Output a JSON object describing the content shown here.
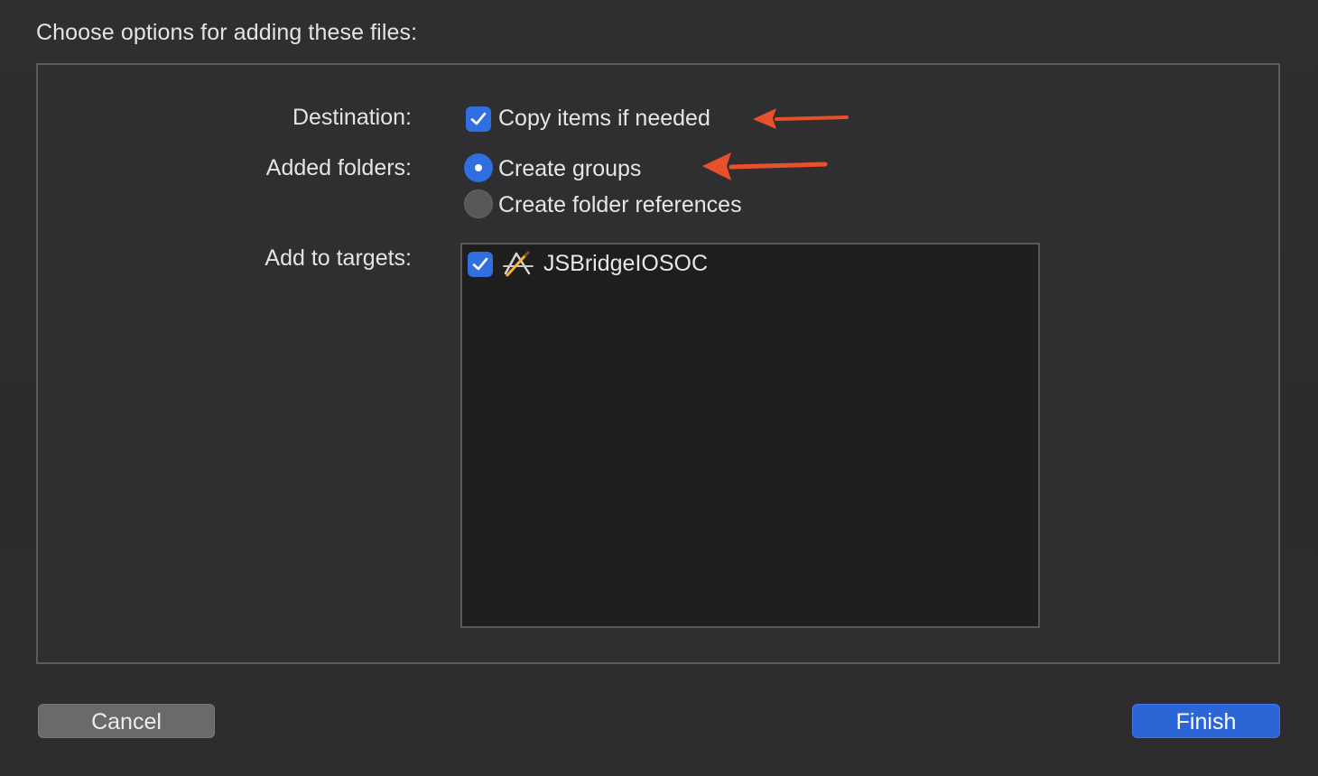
{
  "dialog": {
    "heading": "Choose options for adding these files:"
  },
  "destination": {
    "label": "Destination:",
    "checkbox_label": "Copy items if needed",
    "checked": true
  },
  "added_folders": {
    "label": "Added folders:",
    "options": [
      {
        "label": "Create groups",
        "selected": true
      },
      {
        "label": "Create folder references",
        "selected": false
      }
    ]
  },
  "targets": {
    "label": "Add to targets:",
    "items": [
      {
        "name": "JSBridgeIOSOC",
        "checked": true,
        "icon": "app-target-icon"
      }
    ]
  },
  "buttons": {
    "cancel": "Cancel",
    "finish": "Finish"
  },
  "colors": {
    "accent": "#2f6fe0",
    "annotation": "#e8502a",
    "background": "#2f2f31"
  }
}
